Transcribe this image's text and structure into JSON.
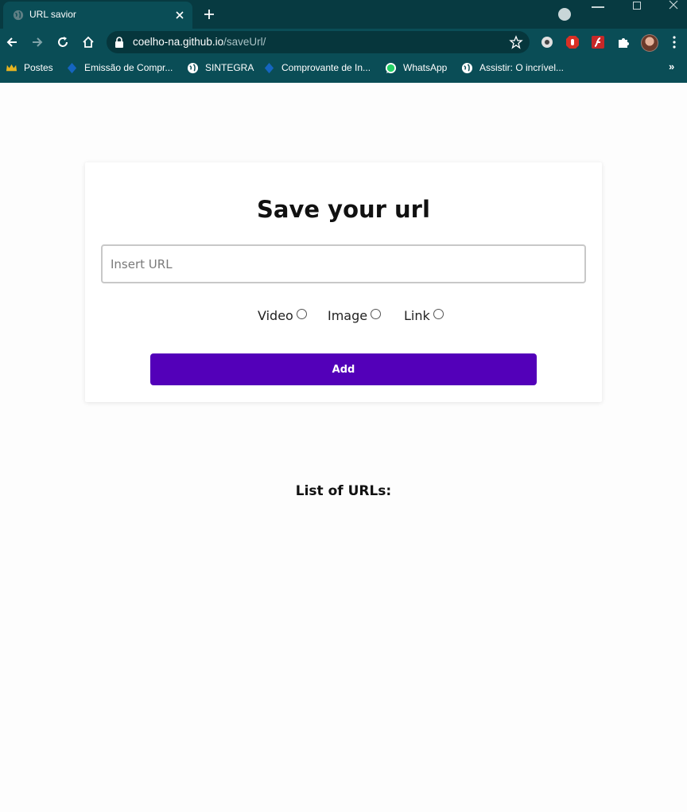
{
  "browser": {
    "tab_title": "URL savior",
    "url_host": "coelho-na.github.io",
    "url_path": "/saveUrl/",
    "bookmarks": [
      "Postes",
      "Emissão de Compr...",
      "SINTEGRA",
      "Comprovante de In...",
      "WhatsApp",
      "Assistir: O incrível..."
    ],
    "bookmarks_overflow": "»",
    "colors": {
      "frame": "#073a41",
      "toolbar": "#0a4d56"
    }
  },
  "page": {
    "title": "Save your url",
    "input_placeholder": "Insert URL",
    "radio_options": [
      "Video",
      "Image",
      "Link"
    ],
    "add_button": "Add",
    "list_heading": "List of URLs:",
    "accent_color": "#5300b9"
  }
}
